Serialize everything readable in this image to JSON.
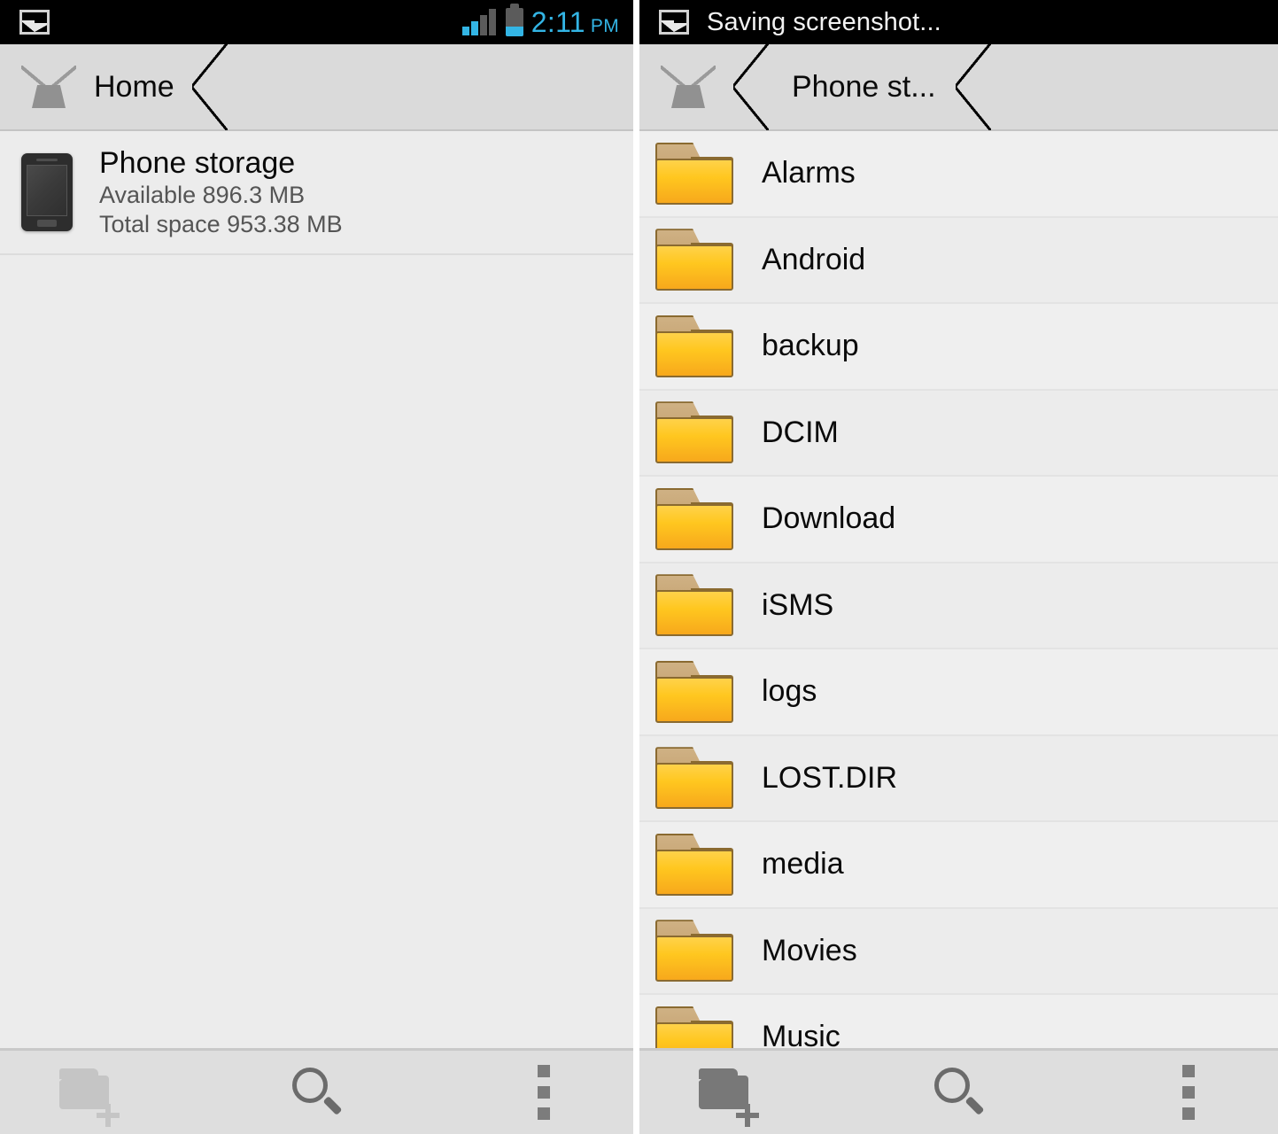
{
  "left": {
    "statusbar": {
      "notification_icon": "picture-icon",
      "signal_icon": "signal-bars-icon",
      "battery_icon": "battery-icon",
      "time": "2:11",
      "ampm": "PM"
    },
    "breadcrumb": {
      "home_icon": "home-icon",
      "home_label": "Home"
    },
    "storage": {
      "device_icon": "phone-icon",
      "title": "Phone storage",
      "available": "Available 896.3 MB",
      "total": "Total space 953.38 MB"
    },
    "toolbar": {
      "new_folder_icon": "new-folder-icon",
      "search_icon": "search-icon",
      "overflow_icon": "overflow-menu-icon"
    }
  },
  "right": {
    "statusbar": {
      "notification_icon": "picture-icon",
      "notification_text": "Saving screenshot..."
    },
    "breadcrumb": {
      "home_icon": "home-icon",
      "current_label": "Phone st..."
    },
    "files": [
      {
        "icon": "folder-icon",
        "name": "Alarms"
      },
      {
        "icon": "folder-icon",
        "name": "Android"
      },
      {
        "icon": "folder-icon",
        "name": "backup"
      },
      {
        "icon": "folder-icon",
        "name": "DCIM"
      },
      {
        "icon": "folder-icon",
        "name": "Download"
      },
      {
        "icon": "folder-icon",
        "name": "iSMS"
      },
      {
        "icon": "folder-icon",
        "name": "logs"
      },
      {
        "icon": "folder-icon",
        "name": "LOST.DIR"
      },
      {
        "icon": "folder-icon",
        "name": "media"
      },
      {
        "icon": "folder-icon",
        "name": "Movies"
      },
      {
        "icon": "folder-icon",
        "name": "Music"
      }
    ],
    "toolbar": {
      "new_folder_icon": "new-folder-icon",
      "search_icon": "search-icon",
      "overflow_icon": "overflow-menu-icon"
    }
  },
  "colors": {
    "accent": "#33b5e5",
    "statusbar_bg": "#000000",
    "breadcrumb_bg": "#dadada",
    "content_bg": "#ececec",
    "toolbar_bg": "#dedede",
    "folder_yellow": "#ffc71f",
    "folder_border": "#8a6a30"
  }
}
